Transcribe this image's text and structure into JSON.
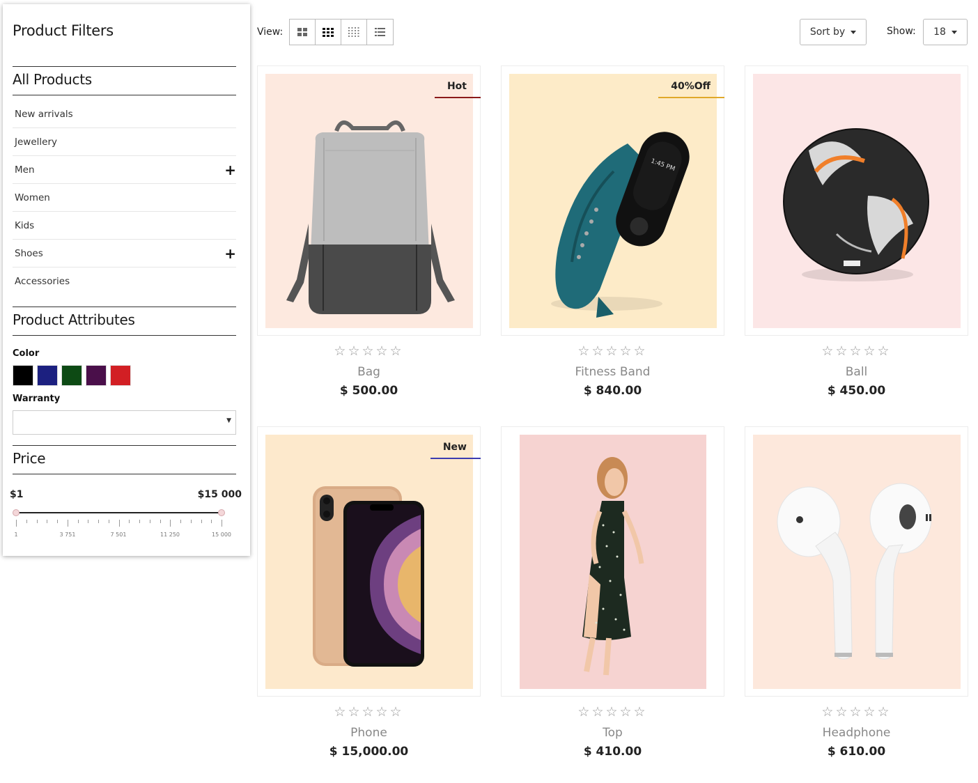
{
  "sidebar": {
    "title": "Product Filters",
    "categories_heading": "All Products",
    "categories": [
      {
        "label": "New arrivals",
        "expandable": false
      },
      {
        "label": "Jewellery",
        "expandable": false
      },
      {
        "label": "Men",
        "expandable": true
      },
      {
        "label": "Women",
        "expandable": false
      },
      {
        "label": "Kids",
        "expandable": false
      },
      {
        "label": "Shoes",
        "expandable": true
      },
      {
        "label": "Accessories",
        "expandable": false
      }
    ],
    "attributes_heading": "Product Attributes",
    "color_label": "Color",
    "colors": [
      "#000000",
      "#1c2080",
      "#0d4a14",
      "#4a0f4a",
      "#d21f24"
    ],
    "warranty_label": "Warranty",
    "warranty_value": "",
    "price_heading": "Price",
    "price_min": "$1",
    "price_max": "$15 000",
    "scale_labels": [
      "1",
      "3 751",
      "7 501",
      "11 250",
      "15 000"
    ]
  },
  "toolbar": {
    "view_label": "View:",
    "view_options": [
      "grid-2-icon",
      "grid-3-icon",
      "grid-4-icon",
      "list-icon"
    ],
    "active_view": 1,
    "sort_label": "Sort by",
    "show_label": "Show:",
    "show_value": "18"
  },
  "products": [
    {
      "name": "Bag",
      "price": "$ 500.00",
      "badge": "Hot",
      "badge_color": "#8b1a1a",
      "bg": "#fde9df",
      "rating": 0
    },
    {
      "name": "Fitness Band",
      "price": "$ 840.00",
      "badge": "40%Off",
      "badge_color": "#e0a82a",
      "bg": "#fdebc8",
      "rating": 0
    },
    {
      "name": "Ball",
      "price": "$ 450.00",
      "badge": "",
      "badge_color": "",
      "bg": "#fce6e6",
      "rating": 0
    },
    {
      "name": "Phone",
      "price": "$ 15,000.00",
      "badge": "New",
      "badge_color": "#3b3bb0",
      "bg": "#fde9cc",
      "rating": 0
    },
    {
      "name": "Top",
      "price": "$ 410.00",
      "badge": "",
      "badge_color": "",
      "bg": "#f6d3d1",
      "rating": 0
    },
    {
      "name": "Headphone",
      "price": "$ 610.00",
      "badge": "",
      "badge_color": "",
      "bg": "#fde8dc",
      "rating": 0
    }
  ]
}
